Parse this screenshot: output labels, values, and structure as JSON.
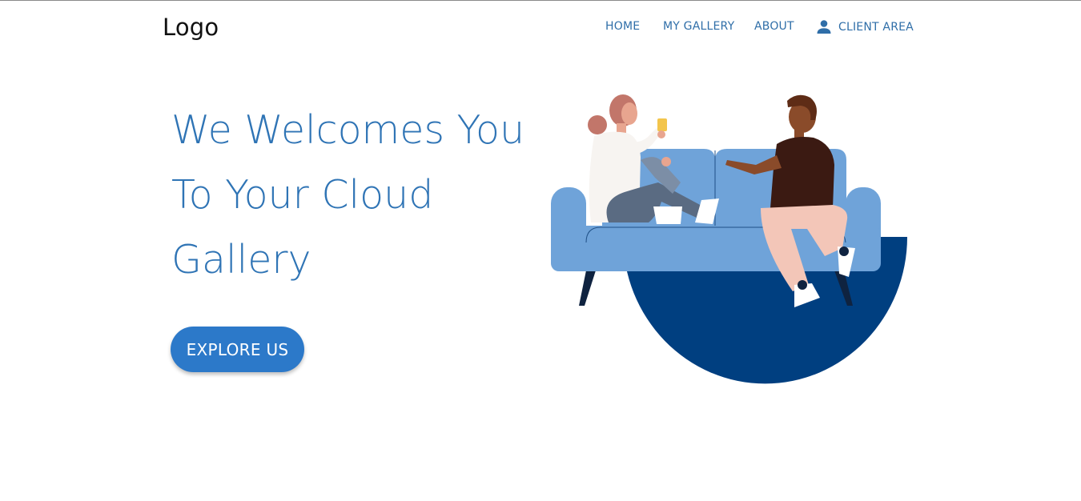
{
  "header": {
    "logo": "Logo",
    "nav": [
      {
        "label": "HOME"
      },
      {
        "label": "MY GALLERY"
      },
      {
        "label": "ABOUT"
      },
      {
        "label": "CLIENT AREA",
        "icon": "person-icon"
      }
    ]
  },
  "hero": {
    "title_lines": [
      "We Welcomes You",
      "To Your Cloud",
      "Gallery"
    ],
    "cta_label": "EXPLORE US"
  },
  "colors": {
    "nav_text": "#2f6ea8",
    "title": "#2f74b5",
    "button": "#2c79c9",
    "sofa": "#6fa3d9",
    "circle": "#003f80"
  },
  "illustration": {
    "name": "two-people-talking-on-sofa-illustration"
  }
}
